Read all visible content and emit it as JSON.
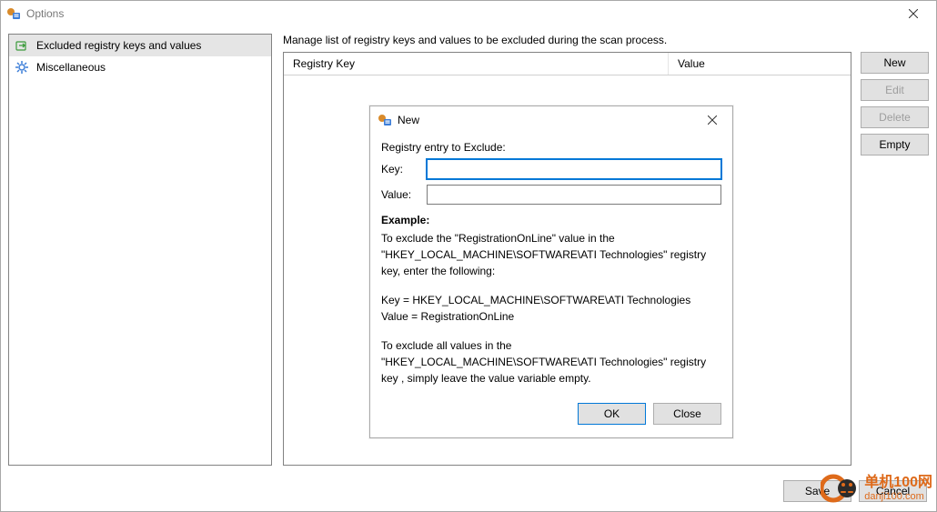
{
  "window": {
    "title": "Options"
  },
  "sidebar": {
    "items": [
      {
        "label": "Excluded registry keys and values"
      },
      {
        "label": "Miscellaneous"
      }
    ]
  },
  "main": {
    "description": "Manage list of registry keys and values to be excluded during the scan process.",
    "columns": {
      "key": "Registry Key",
      "value": "Value"
    }
  },
  "buttons": {
    "new": "New",
    "edit": "Edit",
    "delete": "Delete",
    "empty": "Empty",
    "save": "Save",
    "cancel": "Cancel"
  },
  "dialog": {
    "title": "New",
    "prompt": "Registry entry to Exclude:",
    "key_label": "Key:",
    "value_label": "Value:",
    "key_value": "",
    "value_value": "",
    "example_heading": "Example:",
    "example_p1": "To exclude the \"RegistrationOnLine\" value in the \"HKEY_LOCAL_MACHINE\\SOFTWARE\\ATI Technologies\" registry key, enter the following:",
    "example_p2": "Key = HKEY_LOCAL_MACHINE\\SOFTWARE\\ATI Technologies\nValue = RegistrationOnLine",
    "example_p3": "To exclude all values in the \"HKEY_LOCAL_MACHINE\\SOFTWARE\\ATI Technologies\" registry key , simply leave the value variable empty.",
    "ok": "OK",
    "close": "Close"
  },
  "watermark": {
    "cn": "单机100网",
    "url": "danji100.com"
  }
}
